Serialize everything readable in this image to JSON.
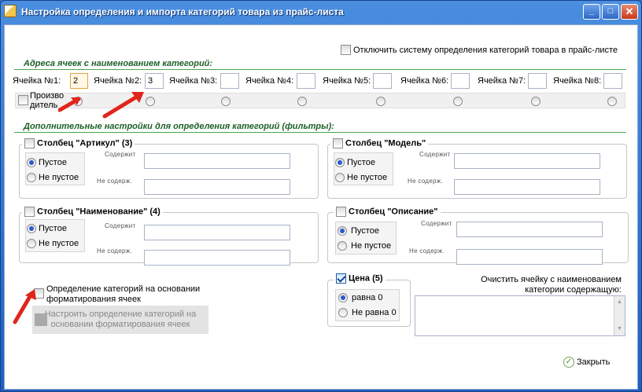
{
  "window": {
    "title": "Настройка определения и импорта категорий товара из прайс-листа",
    "buttons": {
      "minimize": "_",
      "maximize": "□",
      "close": "✕"
    }
  },
  "disable_system_label": "Отключить систему определения категорий товара в прайс-листе",
  "cell_addresses": {
    "heading": "Адреса ячеек с наименованием категорий:",
    "cells": [
      {
        "label": "Ячейка №1:",
        "value": "2"
      },
      {
        "label": "Ячейка №2:",
        "value": "3"
      },
      {
        "label": "Ячейка №3:",
        "value": ""
      },
      {
        "label": "Ячейка №4:",
        "value": ""
      },
      {
        "label": "Ячейка №5:",
        "value": ""
      },
      {
        "label": "Ячейка №6:",
        "value": ""
      },
      {
        "label": "Ячейка №7:",
        "value": ""
      },
      {
        "label": "Ячейка №8:",
        "value": ""
      }
    ],
    "manufacturer_label_1": "Произво",
    "manufacturer_label_2": "дитель"
  },
  "filters": {
    "heading": "Дополнительные настройки для определения категорий (фильтры):",
    "empty": "Пустое",
    "not_empty": "Не пустое",
    "contains": "Содержит",
    "not_contains": "Не содерж.",
    "groups": [
      {
        "title": "Столбец \"Артикул\" (3)",
        "checked": false,
        "selected": "empty"
      },
      {
        "title": "Столбец \"Модель\"",
        "checked": false,
        "selected": "empty"
      },
      {
        "title": "Столбец \"Наименование\" (4)",
        "checked": false,
        "selected": "empty"
      },
      {
        "title": "Столбец \"Описание\"",
        "checked": false,
        "selected": "empty"
      }
    ],
    "price": {
      "title": "Цена (5)",
      "checked": true,
      "equal_zero": "равна 0",
      "not_equal_zero": "Не равна 0",
      "selected": "equal_zero"
    }
  },
  "format_detection": {
    "label_line1": "Определение категорий на основании",
    "label_line2": "форматирования ячеек",
    "configure_line1": "Настроить определение категорий на",
    "configure_line2": "основании форматирования ячеек"
  },
  "clear_cell": {
    "label_line1": "Очистить ячейку с наименованием",
    "label_line2": "категории содержащую:",
    "value": ""
  },
  "close_button": "Закрыть",
  "colors": {
    "titlebar": "#2f6fc6",
    "section_heading": "#1e5f26",
    "section_line": "#4aa548",
    "arrow": "#e0261c"
  }
}
